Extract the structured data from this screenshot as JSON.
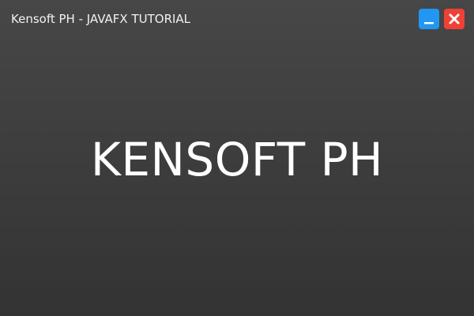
{
  "window": {
    "title": "Kensoft PH - JAVAFX TUTORIAL"
  },
  "controls": {
    "minimize_icon": "minimize-icon",
    "close_icon": "close-icon",
    "minimize_color": "#2196f3",
    "close_color": "#ef4136"
  },
  "main": {
    "brand_text": "KENSOFT PH"
  }
}
